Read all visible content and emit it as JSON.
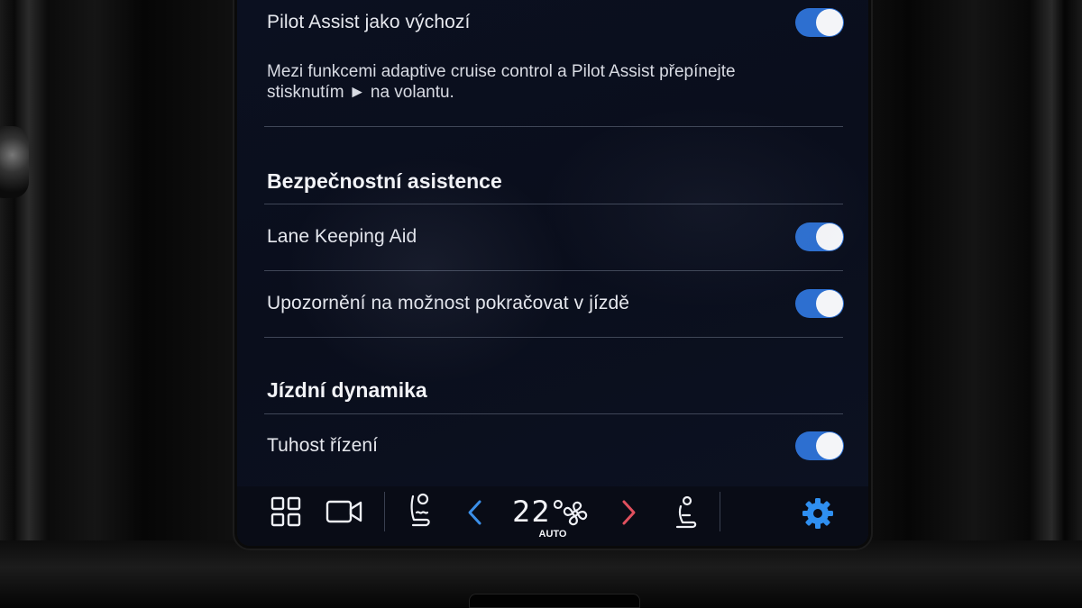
{
  "settings": {
    "pilot_assist_default": {
      "label": "Pilot Assist jako výchozí",
      "enabled": true
    },
    "pilot_assist_description": [
      "Mezi funkcemi adaptive cruise control a Pilot Assist přepínejte",
      "stisknutím ► na volantu."
    ],
    "safety_section": {
      "title": "Bezpečnostní asistence"
    },
    "lane_keeping_aid": {
      "label": "Lane Keeping Aid",
      "enabled": true
    },
    "lane_continue_warning": {
      "label": "Upozornění na možnost pokračovat v jízdě",
      "enabled": true
    },
    "driving_dynamics_section": {
      "title": "Jízdní dynamika"
    },
    "steering_force": {
      "label": "Tuhost řízení",
      "enabled": true
    }
  },
  "bottom_bar": {
    "apps_icon": "grid-icon",
    "camera_icon": "camera-icon",
    "driver_seat_heat_icon": "seat-heat-icon",
    "temp_down_icon": "chevron-left-icon",
    "temperature": "22°",
    "fan_icon": "fan-icon",
    "climate_mode": "AUTO",
    "temp_up_icon": "chevron-right-icon",
    "passenger_seat_icon": "seat-icon",
    "settings_icon": "gear-icon"
  },
  "colors": {
    "toggle_on": "#2d6fd0",
    "accent_blue": "#3b8fe8",
    "accent_red": "#e0505e",
    "gear_blue": "#2f8ff0"
  }
}
